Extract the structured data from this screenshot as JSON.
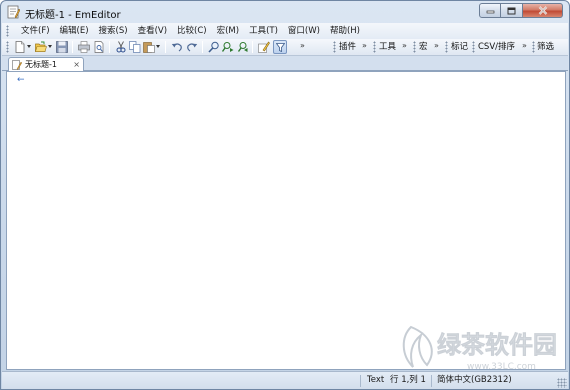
{
  "window": {
    "title": "无标题-1 - EmEditor",
    "buttons": {
      "minimize_icon": "minimize-icon",
      "maximize_icon": "maximize-icon",
      "close_icon": "close-icon"
    }
  },
  "menu": {
    "items": [
      {
        "label": "文件(F)"
      },
      {
        "label": "编辑(E)"
      },
      {
        "label": "搜索(S)"
      },
      {
        "label": "查看(V)"
      },
      {
        "label": "比较(C)"
      },
      {
        "label": "宏(M)"
      },
      {
        "label": "工具(T)"
      },
      {
        "label": "窗口(W)"
      },
      {
        "label": "帮助(H)"
      }
    ]
  },
  "toolbar": {
    "more_glyph": "»",
    "groups": [
      {
        "label": "插件"
      },
      {
        "label": "工具"
      },
      {
        "label": "宏"
      },
      {
        "label": "标记"
      },
      {
        "label": "CSV/排序"
      },
      {
        "label": "筛选"
      }
    ]
  },
  "tabs": [
    {
      "label": "无标题-1",
      "close_glyph": "×",
      "active": true
    }
  ],
  "editor": {
    "content": "",
    "return_mark": "←"
  },
  "status": {
    "mode": "Text",
    "position": "行 1,列 1",
    "encoding": "简体中文(GB2312)"
  },
  "watermark": {
    "name": "绿茶软件园",
    "url": "www.33LC.com"
  },
  "colors": {
    "accent": "#3a6fc4",
    "frame": "#c9d8ea",
    "close_button": "#c04a35"
  }
}
